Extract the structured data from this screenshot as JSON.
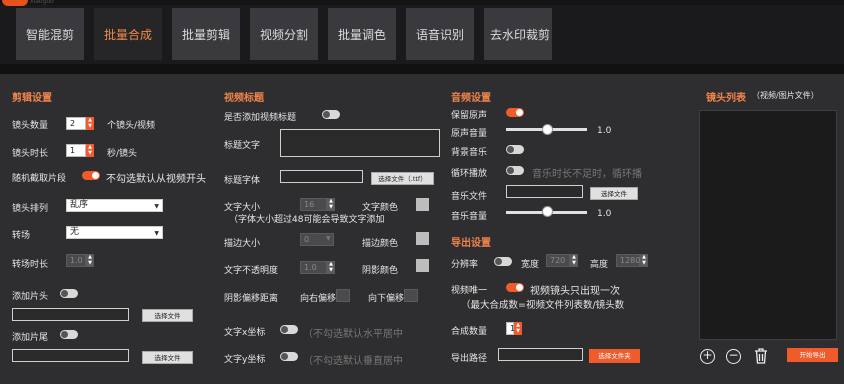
{
  "logo_text": "xiaoguo",
  "tabs": [
    "智能混剪",
    "批量合成",
    "批量剪辑",
    "视频分割",
    "批量调色",
    "语音识别",
    "去水印裁剪"
  ],
  "edit": {
    "title": "剪辑设置",
    "shot_count_label": "镜头数量",
    "shot_count": "2",
    "shot_count_unit": "个镜头/视频",
    "shot_len_label": "镜头时长",
    "shot_len": "1",
    "shot_len_unit": "秒/镜头",
    "random_label": "随机截取片段",
    "random_hint": "不勾选默认从视频开头",
    "order_label": "镜头排列",
    "order_value": "乱序",
    "trans_label": "转场",
    "trans_value": "无",
    "trans_dur_label": "转场时长",
    "trans_dur": "1.0",
    "intro_label": "添加片头",
    "outro_label": "添加片尾",
    "choose_file": "选择文件"
  },
  "vtitle": {
    "title": "视频标题",
    "add_label": "是否添加视频标题",
    "text_label": "标题文字",
    "font_label": "标题字体",
    "font_btn": "选择文件（.ttf）",
    "size_label": "文字大小",
    "size_value": "16",
    "size_hint": "（字体大小超过48可能会导致文字添加",
    "color_label": "文字颜色",
    "stroke_label": "描边大小",
    "stroke_value": "0",
    "stroke_color_label": "描边颜色",
    "opacity_label": "文字不透明度",
    "opacity_value": "1.0",
    "shadow_label": "阴影颜色",
    "shadow_offset_label": "阴影偏移距离",
    "right_label": "向右偏移",
    "down_label": "向下偏移",
    "x_label": "文字x坐标",
    "x_hint": "（不勾选默认水平居中",
    "y_label": "文字y坐标",
    "y_hint": "（不勾选默认垂直居中"
  },
  "audio": {
    "title": "音频设置",
    "keep_label": "保留原声",
    "orig_vol_label": "原声音量",
    "orig_vol": "1.0",
    "bgm_label": "背景音乐",
    "loop_label": "循环播放",
    "loop_hint": "音乐时长不足时，循环播",
    "music_file_label": "音乐文件",
    "music_btn": "选择文件",
    "music_vol_label": "音乐音量",
    "music_vol": "1.0"
  },
  "export": {
    "title": "导出设置",
    "res_label": "分辨率",
    "width_label": "宽度",
    "width": "720",
    "height_label": "高度",
    "height": "1280",
    "unique_label": "视频唯一",
    "unique_hint": "视频镜头只出现一次",
    "unique_hint2": "（最大合成数=视频文件列表数/镜头数",
    "count_label": "合成数量",
    "count": "1",
    "path_label": "导出路径",
    "path_btn": "选择文件夹"
  },
  "list": {
    "title": "镜头列表",
    "subtitle": "（视频/图片文件）",
    "add": "+",
    "remove": "−",
    "start": "开始导出"
  },
  "colors": {
    "accent": "#ef5b2b",
    "tab_active_text": "#f08a4b"
  }
}
